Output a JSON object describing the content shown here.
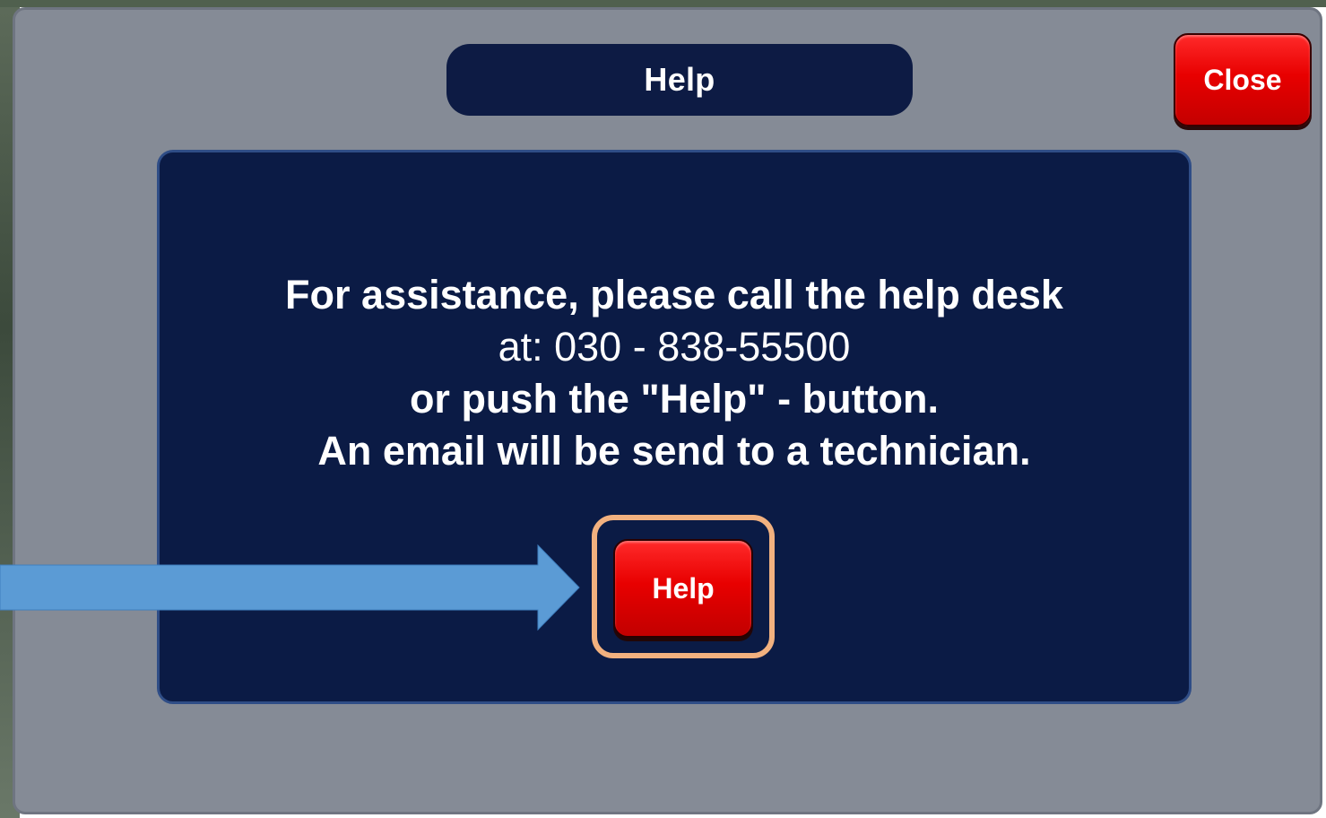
{
  "dialog": {
    "title": "Help",
    "close_label": "Close"
  },
  "message": {
    "line1": "For assistance, please call the help desk",
    "line2": "at: 030 - 838-55500",
    "line3": "or push the \"Help\" - button.",
    "line4": "An email will be send to a technician."
  },
  "help_button": {
    "label": "Help"
  },
  "colors": {
    "dialog_bg": "#858b96",
    "panel_bg": "#0b1b45",
    "button_red": "#e80000",
    "highlight": "#f2b17f",
    "arrow": "#5b9bd5"
  }
}
